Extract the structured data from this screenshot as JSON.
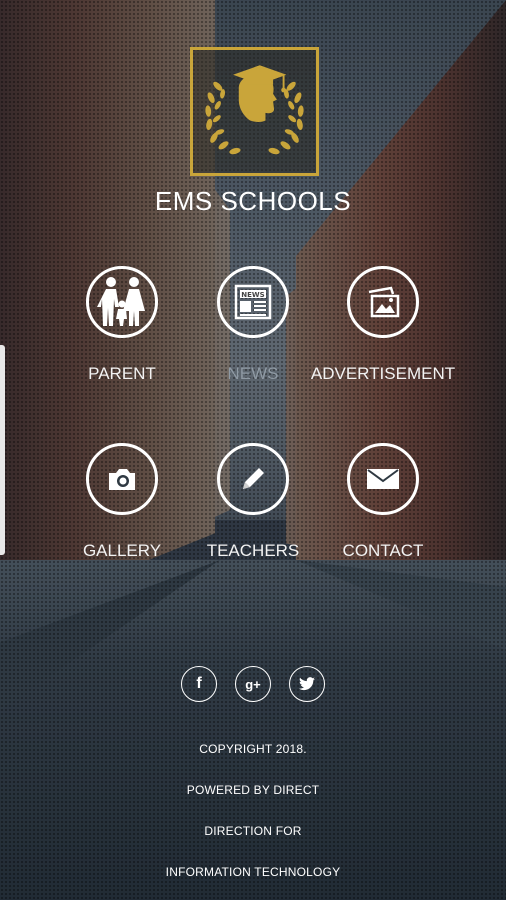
{
  "brand": {
    "title": "EMS SCHOOLS",
    "accent": "#c9a53a"
  },
  "menu": [
    {
      "label": "PARENT",
      "icon": "family-icon"
    },
    {
      "label": "NEWS",
      "icon": "newspaper-icon"
    },
    {
      "label": "ADVERTISEMENT",
      "icon": "advertisement-icon"
    },
    {
      "label": "GALLERY",
      "icon": "camera-icon"
    },
    {
      "label": "TEACHERS",
      "icon": "pencil-icon"
    },
    {
      "label": "CONTACT",
      "icon": "envelope-icon"
    }
  ],
  "social": [
    {
      "name": "facebook",
      "glyph": "f"
    },
    {
      "name": "google-plus",
      "glyph": "g+"
    },
    {
      "name": "twitter",
      "glyph": "t"
    }
  ],
  "footer": {
    "line1": "COPYRIGHT 2018.",
    "line2": "POWERED BY DIRECT",
    "line3": "DIRECTION FOR",
    "line4": "INFORMATION TECHNOLOGY"
  }
}
